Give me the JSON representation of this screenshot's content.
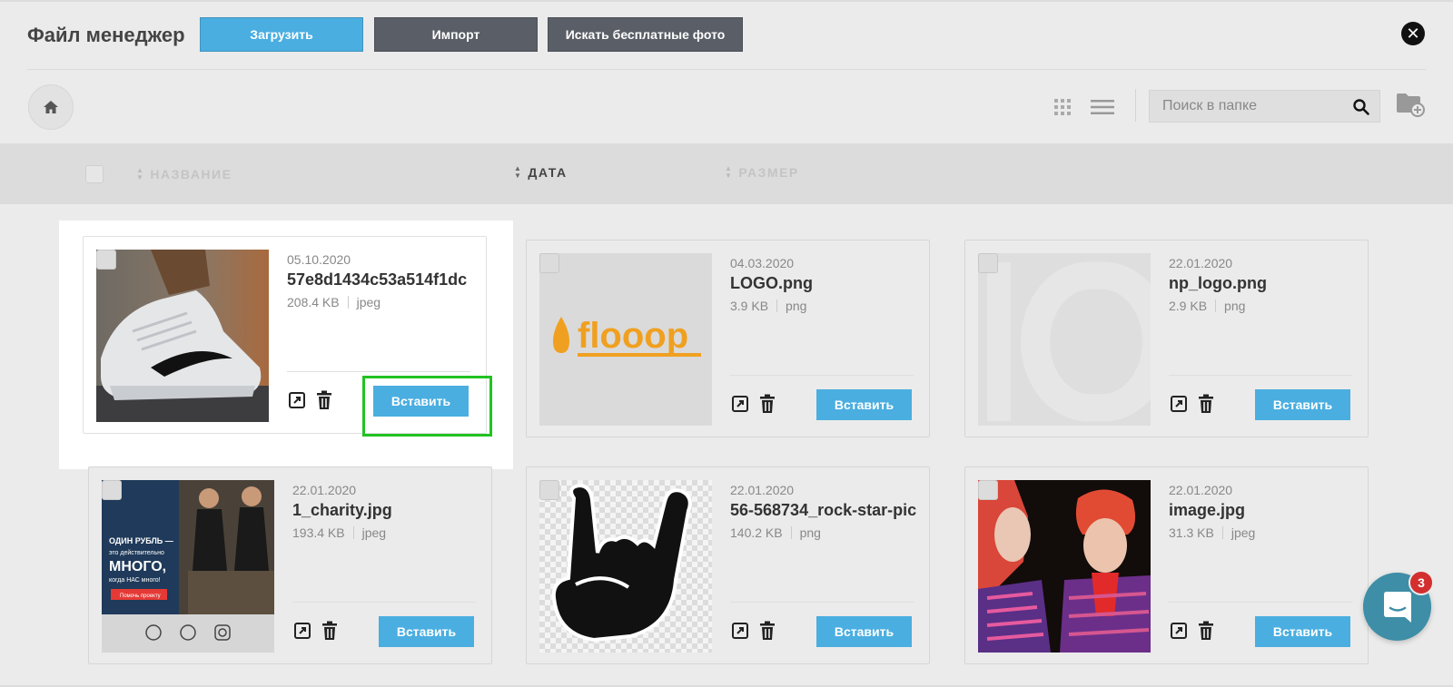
{
  "header": {
    "title": "Файл менеджер",
    "upload_label": "Загрузить",
    "import_label": "Импорт",
    "free_photos_label": "Искать бесплатные фото",
    "close_glyph": "✕"
  },
  "toolbar": {
    "search_placeholder": "Поиск в папке"
  },
  "columns": {
    "name": "НАЗВАНИЕ",
    "date": "ДАТА",
    "size": "РАЗМЕР"
  },
  "files": [
    {
      "date": "05.10.2020",
      "name": "57e8d1434c53a514f1dc",
      "size": "208.4 KB",
      "type": "jpeg",
      "insert_label": "Вставить"
    },
    {
      "date": "04.03.2020",
      "name": "LOGO.png",
      "size": "3.9 KB",
      "type": "png",
      "insert_label": "Вставить",
      "logo_text": "flooop"
    },
    {
      "date": "22.01.2020",
      "name": "np_logo.png",
      "size": "2.9 KB",
      "type": "png",
      "insert_label": "Вставить"
    },
    {
      "date": "22.01.2020",
      "name": "1_charity.jpg",
      "size": "193.4 KB",
      "type": "jpeg",
      "insert_label": "Вставить",
      "poster_lines": [
        "ОДИН РУБЛЬ —",
        "это действительно",
        "МНОГО,",
        "когда НАС много!"
      ],
      "poster_button": "Помочь проекту"
    },
    {
      "date": "22.01.2020",
      "name": "56-568734_rock-star-pic",
      "size": "140.2 KB",
      "type": "png",
      "insert_label": "Вставить"
    },
    {
      "date": "22.01.2020",
      "name": "image.jpg",
      "size": "31.3 KB",
      "type": "jpeg",
      "insert_label": "Вставить"
    }
  ],
  "chat": {
    "badge_count": "3"
  },
  "colors": {
    "accent": "#4aaee0",
    "dark_button": "#5a5e66",
    "highlight": "#22c322",
    "chat": "#3d8ea6",
    "badge": "#d32f2f"
  }
}
